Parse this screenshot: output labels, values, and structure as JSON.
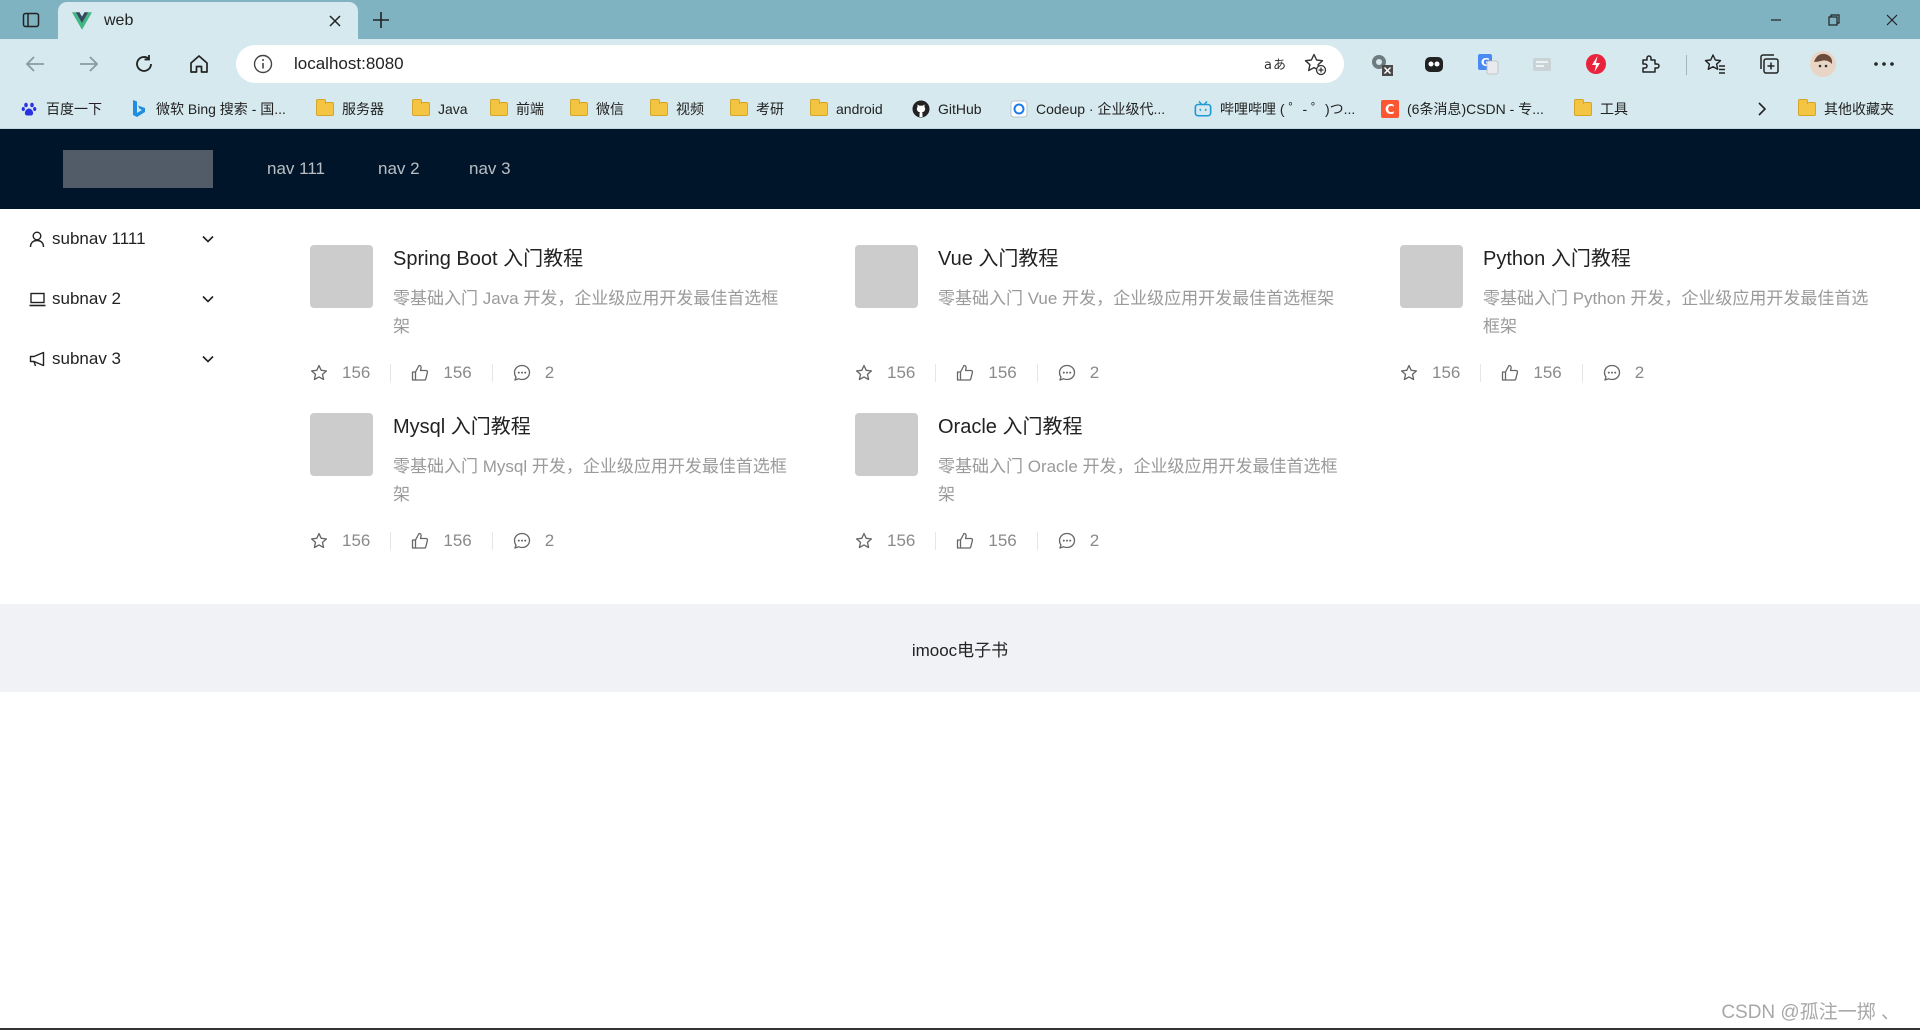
{
  "browser": {
    "tab_title": "web",
    "url": "localhost:8080",
    "bookmarks": [
      {
        "label": "百度一下",
        "icon": "baidu-icon"
      },
      {
        "label": "微软 Bing 搜索 - 国...",
        "icon": "bing-icon"
      },
      {
        "label": "服务器",
        "icon": "folder-icon"
      },
      {
        "label": "Java",
        "icon": "folder-icon"
      },
      {
        "label": "前端",
        "icon": "folder-icon"
      },
      {
        "label": "微信",
        "icon": "folder-icon"
      },
      {
        "label": "视频",
        "icon": "folder-icon"
      },
      {
        "label": "考研",
        "icon": "folder-icon"
      },
      {
        "label": "android",
        "icon": "folder-icon"
      },
      {
        "label": "GitHub",
        "icon": "github-icon"
      },
      {
        "label": "Codeup · 企业级代...",
        "icon": "codeup-icon"
      },
      {
        "label": "哔哩哔哩 ( ゜- ゜)つ...",
        "icon": "bilibili-icon"
      },
      {
        "label": "(6条消息)CSDN - 专...",
        "icon": "csdn-icon"
      },
      {
        "label": "工具",
        "icon": "folder-icon"
      }
    ],
    "other_bookmarks": "其他收藏夹"
  },
  "header": {
    "nav": [
      "nav 111",
      "nav 2",
      "nav 3"
    ]
  },
  "sidebar": {
    "items": [
      {
        "label": "subnav 1111",
        "icon": "user-icon"
      },
      {
        "label": "subnav 2",
        "icon": "laptop-icon"
      },
      {
        "label": "subnav 3",
        "icon": "notification-icon"
      }
    ]
  },
  "list": {
    "items": [
      {
        "title": "Spring Boot 入门教程",
        "description": "零基础入门 Java 开发，企业级应用开发最佳首选框架",
        "stars": "156",
        "likes": "156",
        "comments": "2"
      },
      {
        "title": "Vue 入门教程",
        "description": "零基础入门 Vue 开发，企业级应用开发最佳首选框架",
        "stars": "156",
        "likes": "156",
        "comments": "2"
      },
      {
        "title": "Python 入门教程",
        "description": "零基础入门 Python 开发，企业级应用开发最佳首选框架",
        "stars": "156",
        "likes": "156",
        "comments": "2"
      },
      {
        "title": "Mysql 入门教程",
        "description": "零基础入门 Mysql 开发，企业级应用开发最佳首选框架",
        "stars": "156",
        "likes": "156",
        "comments": "2"
      },
      {
        "title": "Oracle 入门教程",
        "description": "零基础入门 Oracle 开发，企业级应用开发最佳首选框架",
        "stars": "156",
        "likes": "156",
        "comments": "2"
      }
    ]
  },
  "footer": {
    "text": "imooc电子书"
  },
  "watermark": "CSDN @孤注一掷 、",
  "colors": {
    "header_bg": "#001529",
    "footer_bg": "#f0f2f5",
    "chrome_bg": "#d6e9ee",
    "titlebar_bg": "#7fb3c2"
  }
}
